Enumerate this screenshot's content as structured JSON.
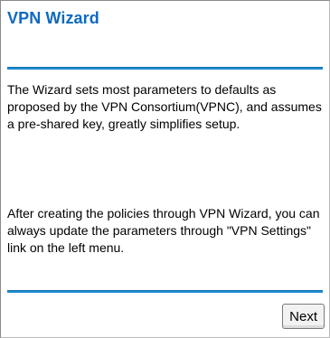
{
  "wizard": {
    "title": "VPN Wizard",
    "intro_text": "The Wizard sets most parameters to defaults as proposed by the VPN Consortium(VPNC), and assumes a pre-shared key, greatly simplifies setup.",
    "update_text": "After creating the policies through VPN Wizard, you can always update the parameters through \"VPN Settings\" link on the left menu.",
    "next_label": "Next"
  },
  "colors": {
    "title": "#0f69bf",
    "rule": "#1e8ed1"
  }
}
